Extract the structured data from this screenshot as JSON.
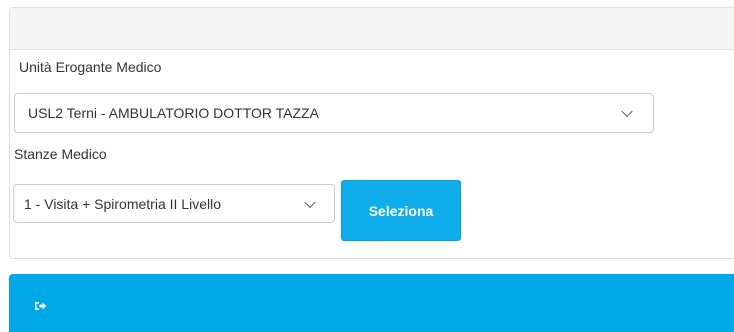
{
  "form": {
    "unit_label": "Unità Erogante Medico",
    "unit_value": "USL2 Terni - AMBULATORIO DOTTOR TAZZA",
    "room_label": "Stanze Medico",
    "room_value": "1 - Visita + Spirometria II Livello",
    "select_button": "Seleziona"
  },
  "colors": {
    "accent": "#0fadea",
    "bottom_bar": "#00a8e8",
    "panel_heading": "#f5f5f5"
  },
  "icons": {
    "bottom_bar": "logout-icon",
    "select_arrow": "chevron-down-icon"
  }
}
